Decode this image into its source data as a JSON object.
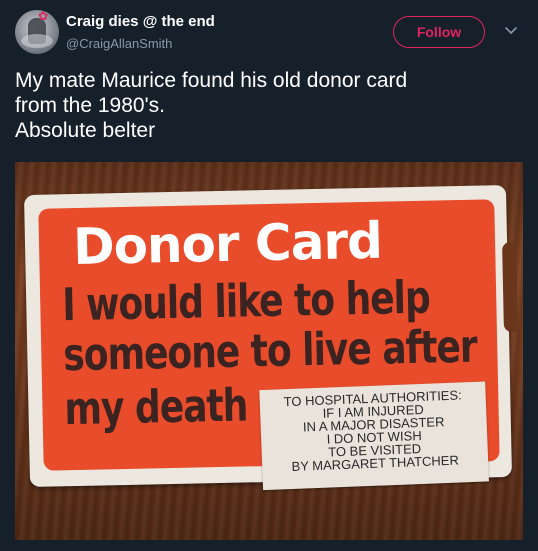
{
  "tweet": {
    "display_name": "Craig dies @ the end",
    "handle": "@CraigAllanSmith",
    "follow_label": "Follow",
    "text_lines": [
      "My mate Maurice found his old donor card",
      "from the 1980's.",
      "Absolute belter"
    ]
  },
  "image": {
    "card_title": "Donor Card",
    "card_lines": [
      "I would like to help",
      "someone to live after",
      "my death"
    ],
    "sticker_lines": [
      "TO HOSPITAL AUTHORITIES:",
      "IF I AM INJURED",
      "IN A MAJOR DISASTER",
      "I DO NOT WISH",
      "TO BE VISITED",
      "BY MARGARET THATCHER"
    ]
  },
  "icons": {
    "menu": "chevron-down-icon",
    "badge": "flower-icon"
  },
  "colors": {
    "background": "#15202b",
    "accent": "#e0245e",
    "secondary_text": "#8899a6",
    "card_red": "#e84c2a"
  }
}
